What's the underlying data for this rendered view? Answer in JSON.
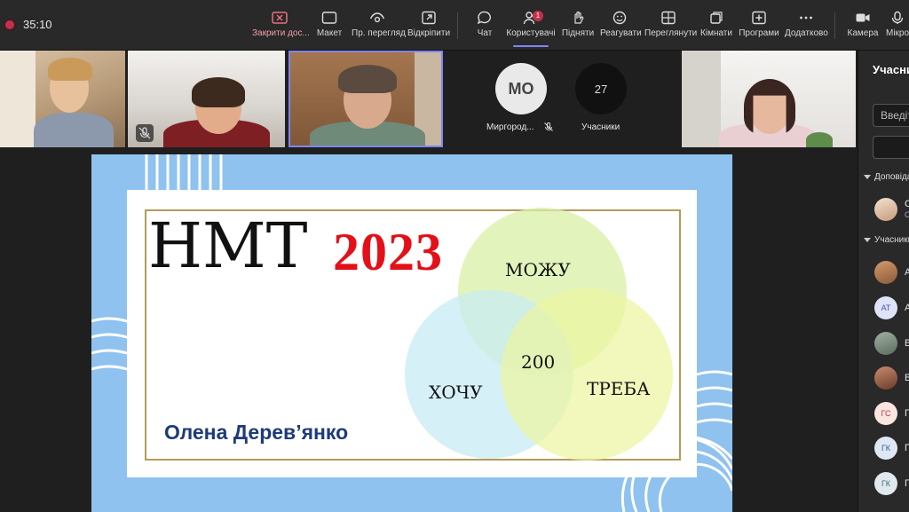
{
  "recording": {
    "timer": "35:10"
  },
  "toolbar": {
    "buttons": [
      {
        "label": "Закрити дос..."
      },
      {
        "label": "Макет"
      },
      {
        "label": "Пр. перегляд"
      },
      {
        "label": "Відкріпити"
      },
      {
        "label": "Чат"
      },
      {
        "label": "Користувачі",
        "badge": "1"
      },
      {
        "label": "Підняти"
      },
      {
        "label": "Реагувати"
      },
      {
        "label": "Переглянути"
      },
      {
        "label": "Кімнати"
      },
      {
        "label": "Програми"
      },
      {
        "label": "Додатково"
      },
      {
        "label": "Камера"
      },
      {
        "label": "Мікро"
      }
    ]
  },
  "participants": {
    "mo_initials": "МО",
    "mo_name": "Миргород...",
    "count": "27",
    "count_label": "Учасники"
  },
  "slide": {
    "title": "НМТ",
    "year": "2023",
    "venn": {
      "top": "МОЖУ",
      "left": "ХОЧУ",
      "right": "ТРЕБА",
      "center": "200"
    },
    "author": "Олена Дерев’янко",
    "colors": {
      "background": "#8fc2ef",
      "year": "#e3101a",
      "author": "#1f3a7a",
      "frame": "#b39b5a"
    }
  },
  "sidebar": {
    "title": "Учасники",
    "search_placeholder": "Введіть",
    "section_presenters": "Доповідачі",
    "section_attendees": "Учасники",
    "presenter": {
      "letter": "С",
      "sub": "О"
    },
    "rows": [
      {
        "initials": "",
        "letter": "А"
      },
      {
        "initials": "АТ",
        "letter": "А"
      },
      {
        "initials": "",
        "letter": "В"
      },
      {
        "initials": "",
        "letter": "В"
      },
      {
        "initials": "ГС",
        "letter": "Г"
      },
      {
        "initials": "ГК",
        "letter": "Г"
      },
      {
        "initials": "ГК",
        "letter": "Г"
      }
    ]
  }
}
